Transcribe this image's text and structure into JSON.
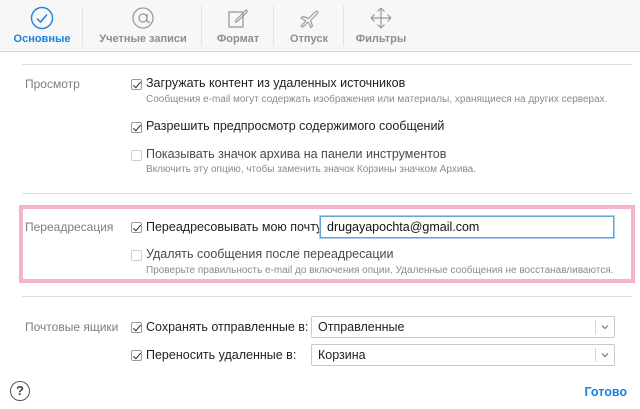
{
  "toolbar": {
    "tabs": [
      {
        "label": "Основные",
        "icon": "checkmark-circle-icon",
        "active": true
      },
      {
        "label": "Учетные записи",
        "icon": "at-sign-icon",
        "active": false
      },
      {
        "label": "Формат",
        "icon": "compose-icon",
        "active": false
      },
      {
        "label": "Отпуск",
        "icon": "airplane-icon",
        "active": false
      },
      {
        "label": "Фильтры",
        "icon": "filter-arrows-icon",
        "active": false
      }
    ]
  },
  "viewing": {
    "label": "Просмотр",
    "options": [
      {
        "label": "Загружать контент из удаленных источников",
        "checked": true,
        "hint": "Сообщения e-mail могут содержать изображения или материалы, хранящиеся на других серверах."
      },
      {
        "label": "Разрешить предпросмотр содержимого сообщений",
        "checked": true,
        "hint": ""
      },
      {
        "label": "Показывать значок архива на панели инструментов",
        "checked": false,
        "hint": "Включить эту опцию, чтобы заменить значок Корзины значком Архива."
      }
    ]
  },
  "forwarding": {
    "label": "Переадресация",
    "forward_label": "Переадресовывать мою почту:",
    "forward_checked": true,
    "forward_email": "drugayapochta@gmail.com",
    "delete_label": "Удалять сообщения после переадресации",
    "delete_checked": false,
    "delete_hint": "Проверьте правильность e-mail до включения опции. Удаленные сообщения не восстанавливаются."
  },
  "mailboxes": {
    "label": "Почтовые ящики",
    "save_sent_label": "Сохранять отправленные в:",
    "save_sent_checked": true,
    "save_sent_value": "Отправленные",
    "move_deleted_label": "Переносить удаленные в:",
    "move_deleted_checked": true,
    "move_deleted_value": "Корзина"
  },
  "footer": {
    "help": "?",
    "done": "Готово"
  },
  "colors": {
    "accent": "#1a82e2",
    "highlight": "#f5b3cf"
  }
}
